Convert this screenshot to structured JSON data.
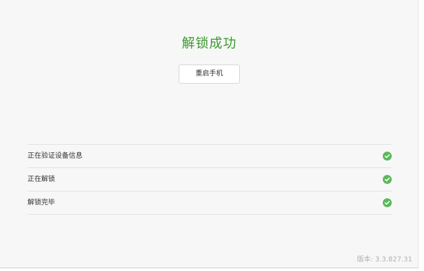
{
  "title": "解锁成功",
  "restart_button": "重启手机",
  "steps": [
    {
      "label": "正在验证设备信息",
      "status_icon": "check-circle-icon"
    },
    {
      "label": "正在解锁",
      "status_icon": "check-circle-icon"
    },
    {
      "label": "解锁完毕",
      "status_icon": "check-circle-icon"
    }
  ],
  "version_text": "版本: 3.3.827.31",
  "colors": {
    "success": "#5cb85c",
    "title": "#3a9a2e"
  }
}
